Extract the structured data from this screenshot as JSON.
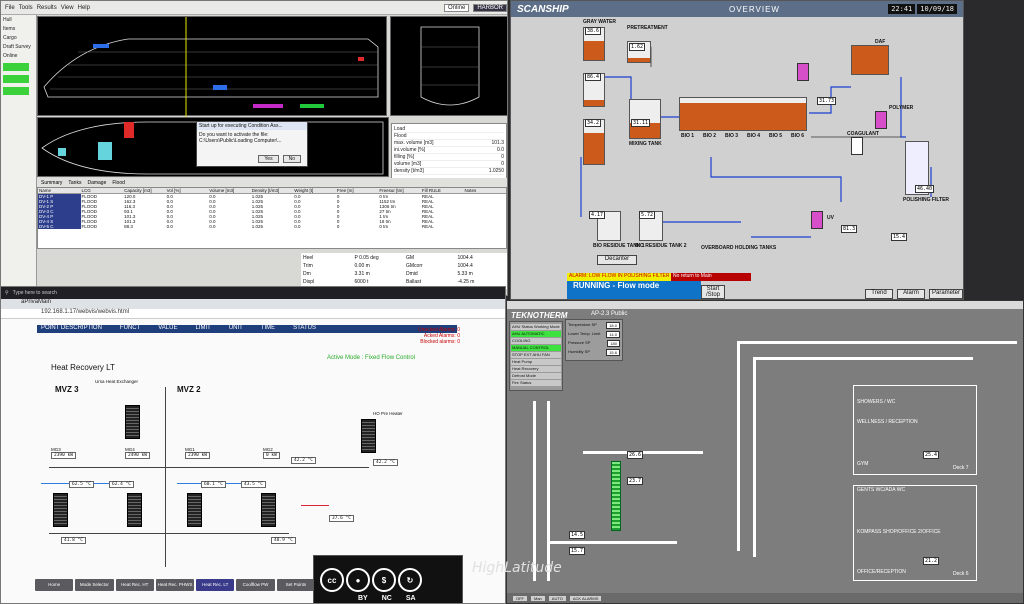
{
  "cad": {
    "menu": [
      "File",
      "Tools",
      "Results",
      "Tools",
      "View",
      "Help"
    ],
    "mode_buttons": [
      "Online",
      "HARBOR"
    ],
    "left_items": [
      "Hull",
      "Items",
      "Cargo",
      "Draft Survey",
      "Online"
    ],
    "dialog_title": "Start up for executing Condition Ass...",
    "dialog_text": "Do you want to activate the file:",
    "dialog_path": "C:\\Users\\Public\\Loading Computer\\...",
    "dialog_yes": "Yes",
    "dialog_no": "No",
    "props": [
      [
        "Load",
        ""
      ],
      [
        "Load",
        ""
      ],
      [
        "Flood",
        ""
      ],
      [
        "max. volume [m3]",
        "101.3"
      ],
      [
        "ini.volume [%]",
        "0.0"
      ],
      [
        "filling [%]",
        "0"
      ],
      [
        "volume [m3]",
        "0"
      ],
      [
        "density [t/m3]",
        "1.0250"
      ]
    ],
    "tabs": [
      "Summary",
      "Tanks",
      "Damage",
      "Flood"
    ],
    "table_head": [
      "Name",
      "LCG",
      "Capacity [m3]",
      "Vol [%]",
      "Volume [m3]",
      "Density [t/m3]",
      "Weight [t]",
      "Free [m]",
      "Freesur [tm]",
      "Fill RULE",
      "Notes"
    ],
    "table_rows": [
      [
        "DV-1 P",
        "FLOOD",
        "120.0",
        "0.0",
        "0.0",
        "1.025",
        "0.0",
        "0",
        "0 tm",
        "REAL",
        ""
      ],
      [
        "DV-1 S",
        "FLOOD",
        "162.3",
        "0.0",
        "0.0",
        "1.025",
        "0.0",
        "0",
        "1152 tm",
        "REAL",
        ""
      ],
      [
        "DV-2 P",
        "FLOOD",
        "116.3",
        "0.0",
        "0.0",
        "1.025",
        "0.0",
        "0",
        "1306 tm",
        "REAL",
        ""
      ],
      [
        "DV-3 C",
        "FLOOD",
        "93.1",
        "0.0",
        "0.0",
        "1.025",
        "0.0",
        "0",
        "27 tm",
        "REAL",
        ""
      ],
      [
        "DV-4 P",
        "FLOOD",
        "101.3",
        "0.0",
        "0.0",
        "1.025",
        "0.0",
        "0",
        "1 tm",
        "REAL",
        ""
      ],
      [
        "DV-4 S",
        "FLOOD",
        "101.3",
        "0.0",
        "0.0",
        "1.025",
        "0.0",
        "0",
        "18 tm",
        "REAL",
        ""
      ],
      [
        "DV-5 C",
        "FLOOD",
        "88.3",
        "0.0",
        "0.0",
        "1.025",
        "0.0",
        "0",
        "0 tm",
        "REAL",
        ""
      ]
    ],
    "hydro": [
      "Heel",
      "P 0.05 deg",
      "GM",
      "1004.4",
      "Trim",
      "0.00 m",
      "GMcorr",
      "1004.4",
      "Dm",
      "3.31 m",
      "Dmid",
      "5.33 m",
      "Displ",
      "6000 t",
      "Ballast",
      "-4.25 m"
    ]
  },
  "scanship": {
    "logo": "SCANSHIP",
    "title": "OVERVIEW",
    "time": "22:41",
    "date": "10/09/18",
    "labels": [
      "GRAY WATER",
      "PRETREATMENT",
      "BIO 1",
      "BIO 2",
      "BIO 3",
      "BIO 4",
      "BIO 5",
      "BIO 6",
      "DAF",
      "POLYMER",
      "COAGULANT",
      "UV",
      "BIO RESIDUE TANK 1",
      "BIO RESIDUE TANK 2",
      "OVERBOARD HOLDING TANKS",
      "MIXING TANK",
      "POLISHING FILTER",
      "Decanter"
    ],
    "values": [
      "38.6",
      "86.4",
      "85.2",
      "34.2",
      "1.62",
      "31.11",
      "3.17",
      "0.2",
      "0.7",
      "46.40",
      "81.3",
      "31.73",
      "34.2",
      "4.17",
      "5.72",
      "15.4",
      "3.4",
      "81.8"
    ],
    "alarm": "ALARM: LOW FLOW IN POLISHING FILTER 1",
    "msg": "No return to Main",
    "status_lbl": "AMC STATUS",
    "status": "RUNNING - Flow mode",
    "start_stop": "Start /Stop",
    "buttons": [
      "Trend",
      "Alarm",
      "Parameter"
    ]
  },
  "heat": {
    "taskbar": "Type here to search",
    "tab": "aPrivaMain",
    "url": "192.168.1.17/webvis/webvis.html",
    "head": [
      "POINT DESCRIPTION",
      "FUNCT",
      "VALUE",
      "LIMIT",
      "UNIT",
      "TIME",
      "STATUS"
    ],
    "alarms": [
      "Unacked Alarms: 0",
      "Acked Alarms: 0",
      "Blocked alarms: 0"
    ],
    "title": "Heat Recovery LT",
    "mode": "Active Mode : Fixed Flow Control",
    "zones": [
      "MVZ 3",
      "MVZ 2"
    ],
    "preheater": "HO Pre Heater",
    "exchanger": "Ursa Heat Exchanger",
    "engines": [
      [
        "MG3",
        "2390 kW"
      ],
      [
        "MG4",
        "2490 kW"
      ],
      [
        "MG1",
        "2390 kW"
      ],
      [
        "MG2",
        "0 kW"
      ]
    ],
    "temps": [
      "62.5 °C",
      "62.4 °C",
      "60.1 °C",
      "43.5 °C",
      "42.2 °C",
      "41.8 °C",
      "37.6 °C",
      "48.9 °C",
      "42.2 °C"
    ],
    "bottom_tabs": [
      "Home",
      "Mode Selector",
      "Heat Rec. HT",
      "Heat Rec. PHWS",
      "Heat Rec. LT",
      "Coolflow PW",
      "Set Points"
    ],
    "cc": [
      "cc",
      "BY",
      "NC",
      "SA"
    ],
    "watermark": "HighLatitude"
  },
  "tekno": {
    "top": "TEKNOTHERM",
    "subtitle": "AP-2.3 Public",
    "side": [
      "AHU Status Working Mode",
      "AHU AUTOMATIC",
      "COOLING",
      "MANUAL CONTROL",
      "STOP EXT AHU FAN",
      "Heat Pump",
      "Heat Recovery",
      "Defrost Mode",
      "Fire Status"
    ],
    "setpoints": [
      [
        "Temperature SP",
        "18.0"
      ],
      [
        "Lower Temp. Limit",
        "14.0"
      ],
      [
        "Pressure SP",
        "180"
      ],
      [
        "Humidity SP",
        "15.6"
      ]
    ],
    "zones": [
      "SHOWERS / WC",
      "WELLNESS / RECEPTION",
      "GYM",
      "GENTS WC/ADA WC",
      "KOMPASS SHOP/OFFICE 2/OFFICE",
      "OFFICE/RECEPTION"
    ],
    "decks": [
      "Deck 7",
      "Deck 6"
    ],
    "readings": [
      "26.6",
      "23.7",
      "14.5",
      "11.8",
      "15.7",
      "5.6",
      "23.8",
      "25.4",
      "8.3",
      "21.2"
    ],
    "bottom": [
      "OFF",
      "Man",
      "AUTO",
      "ACK ALARMS"
    ]
  }
}
